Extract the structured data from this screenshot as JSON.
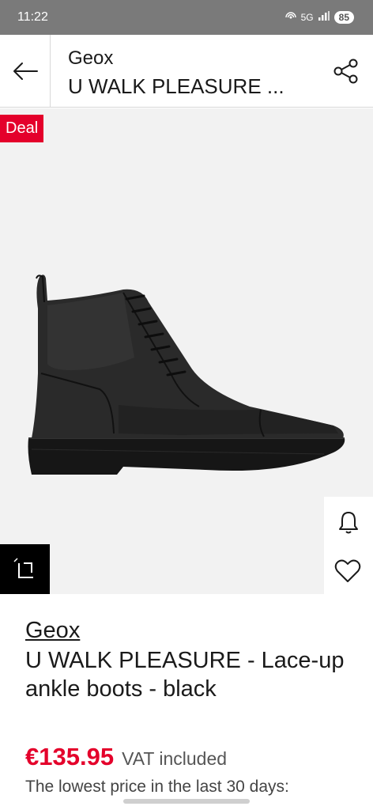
{
  "status_bar": {
    "time": "11:22",
    "network": "5G",
    "battery": "85"
  },
  "header": {
    "brand": "Geox",
    "title": "U WALK PLEASURE ...",
    "back_icon": "arrow-left-icon",
    "share_icon": "share-icon"
  },
  "gallery": {
    "deal_label": "Deal"
  },
  "product": {
    "brand": "Geox",
    "name": "U WALK PLEASURE - Lace-up ankle boots - black",
    "price": "€135.95",
    "vat": "VAT included",
    "lowest_price_note": "The lowest price in the last 30 days:"
  },
  "colors": {
    "accent": "#e4002b",
    "status_bar": "#7a7a7a"
  }
}
